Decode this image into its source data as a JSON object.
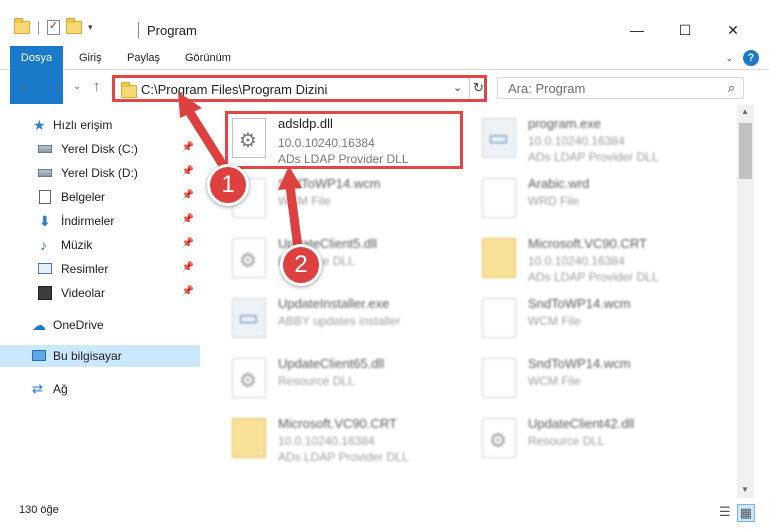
{
  "window": {
    "title": "Program",
    "controls": {
      "minimize": "—",
      "maximize": "☐",
      "close": "✕"
    }
  },
  "ribbon": {
    "tabs": [
      "Dosya",
      "Giriş",
      "Paylaş",
      "Görünüm"
    ],
    "expand_glyph": "⌄",
    "help_glyph": "?"
  },
  "navigation": {
    "back": "←",
    "forward": "→",
    "dropdown": "⌄",
    "up": "↑",
    "address_path": "C:\\Program Files\\Program Dizini",
    "address_dropdown": "⌄",
    "refresh": "↻",
    "search_placeholder": "Ara: Program",
    "search_glyph": "⌕"
  },
  "sidebar": {
    "items": [
      {
        "label": "Hızlı erişim",
        "icon": "star-icon",
        "glyph": "★",
        "pinned": false,
        "selected": false
      },
      {
        "label": "Yerel Disk (C:)",
        "icon": "drive-icon",
        "glyph": "",
        "pinned": true,
        "selected": false
      },
      {
        "label": "Yerel Disk (D:)",
        "icon": "drive-icon",
        "glyph": "",
        "pinned": true,
        "selected": false
      },
      {
        "label": "Belgeler",
        "icon": "documents-icon",
        "glyph": "",
        "pinned": true,
        "selected": false
      },
      {
        "label": "İndirmeler",
        "icon": "download-icon",
        "glyph": "⬇",
        "pinned": true,
        "selected": false
      },
      {
        "label": "Müzik",
        "icon": "music-icon",
        "glyph": "♪",
        "pinned": true,
        "selected": false
      },
      {
        "label": "Resimler",
        "icon": "pictures-icon",
        "glyph": "",
        "pinned": true,
        "selected": false
      },
      {
        "label": "Videolar",
        "icon": "videos-icon",
        "glyph": "",
        "pinned": true,
        "selected": false
      },
      {
        "label": "OneDrive",
        "icon": "cloud-icon",
        "glyph": "☁",
        "pinned": false,
        "selected": false
      },
      {
        "label": "Bu bilgisayar",
        "icon": "computer-icon",
        "glyph": "",
        "pinned": false,
        "selected": true
      },
      {
        "label": "Ağ",
        "icon": "network-icon",
        "glyph": "⇄",
        "pinned": false,
        "selected": false
      }
    ],
    "pin_glyph": "📌"
  },
  "files": [
    {
      "name": "adsldp.dll",
      "lines": [
        "10.0.10240.16384",
        "ADs LDAP Provider DLL"
      ],
      "icon": "dll",
      "highlighted": true
    },
    {
      "name": "program.exe",
      "lines": [
        "10.0.10240.16384",
        "ADs LDAP Provider DLL"
      ],
      "icon": "exe",
      "highlighted": false
    },
    {
      "name": "SndToWP14.wcm",
      "lines": [
        "WCM File"
      ],
      "icon": "doc",
      "highlighted": false
    },
    {
      "name": "Arabic.wrd",
      "lines": [
        "WRD File"
      ],
      "icon": "doc",
      "highlighted": false
    },
    {
      "name": "UpdateClient5.dll",
      "lines": [
        "Resource DLL"
      ],
      "icon": "dll",
      "highlighted": false
    },
    {
      "name": "Microsoft.VC90.CRT",
      "lines": [
        "10.0.10240.16384",
        "ADs LDAP Provider DLL"
      ],
      "icon": "folder",
      "highlighted": false
    },
    {
      "name": "UpdateInstaller.exe",
      "lines": [
        "ABBY updates installer"
      ],
      "icon": "exe",
      "highlighted": false
    },
    {
      "name": "SndToWP14.wcm",
      "lines": [
        "WCM File"
      ],
      "icon": "doc",
      "highlighted": false
    },
    {
      "name": "UpdateClient65.dll",
      "lines": [
        "Resource DLL"
      ],
      "icon": "dll",
      "highlighted": false
    },
    {
      "name": "SndToWP14.wcm",
      "lines": [
        "WCM File"
      ],
      "icon": "doc",
      "highlighted": false
    },
    {
      "name": "Microsoft.VC90.CRT",
      "lines": [
        "10.0.10240.16384",
        "ADs LDAP Provider DLL"
      ],
      "icon": "folder",
      "highlighted": false
    },
    {
      "name": "UpdateClient42.dll",
      "lines": [
        "Resource DLL"
      ],
      "icon": "dll",
      "highlighted": false
    }
  ],
  "status": {
    "item_count": "130 öğe",
    "details_view_glyph": "☰",
    "tiles_view_glyph": "▦"
  },
  "annotations": {
    "step1": "1",
    "step2": "2"
  },
  "colors": {
    "accent": "#1979ca",
    "annotation_red": "#de3f3f",
    "selection": "#cce8ff"
  }
}
